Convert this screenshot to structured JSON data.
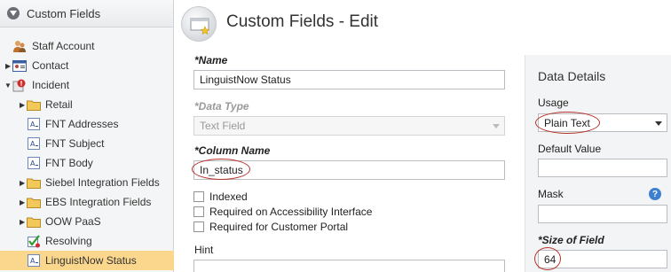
{
  "left_panel": {
    "title": "Custom Fields",
    "tree": [
      {
        "label": "Staff Account",
        "depth": 0,
        "expander": "",
        "icon": "staff-account-icon",
        "selected": false
      },
      {
        "label": "Contact",
        "depth": 0,
        "expander": "collapsed",
        "icon": "contact-card-icon",
        "selected": false
      },
      {
        "label": "Incident",
        "depth": 0,
        "expander": "expanded",
        "icon": "incident-icon",
        "selected": false
      },
      {
        "label": "Retail",
        "depth": 1,
        "expander": "collapsed",
        "icon": "folder-icon",
        "selected": false
      },
      {
        "label": "FNT Addresses",
        "depth": 1,
        "expander": "",
        "icon": "text-field-icon",
        "selected": false
      },
      {
        "label": "FNT Subject",
        "depth": 1,
        "expander": "",
        "icon": "text-field-icon",
        "selected": false
      },
      {
        "label": "FNT Body",
        "depth": 1,
        "expander": "",
        "icon": "text-field-icon",
        "selected": false
      },
      {
        "label": "Siebel Integration Fields",
        "depth": 1,
        "expander": "collapsed",
        "icon": "folder-icon",
        "selected": false
      },
      {
        "label": "EBS Integration Fields",
        "depth": 1,
        "expander": "collapsed",
        "icon": "folder-icon",
        "selected": false
      },
      {
        "label": "OOW PaaS",
        "depth": 1,
        "expander": "collapsed",
        "icon": "folder-icon",
        "selected": false
      },
      {
        "label": "Resolving",
        "depth": 1,
        "expander": "",
        "icon": "checkbox-field-icon",
        "selected": false
      },
      {
        "label": "LinguistNow Status",
        "depth": 1,
        "expander": "",
        "icon": "text-field-icon",
        "selected": true
      }
    ]
  },
  "header": {
    "title": "Custom Fields - Edit"
  },
  "form": {
    "name": {
      "label": "*Name",
      "value": "LinguistNow Status"
    },
    "data_type": {
      "label": "*Data Type",
      "value": "Text Field"
    },
    "column_name": {
      "label": "*Column Name",
      "value": "In_status"
    },
    "checkboxes": [
      {
        "label": "Indexed",
        "checked": false
      },
      {
        "label": "Required on Accessibility Interface",
        "checked": false
      },
      {
        "label": "Required for Customer Portal",
        "checked": false
      }
    ],
    "hint": {
      "label": "Hint",
      "value": ""
    }
  },
  "data_details": {
    "title": "Data Details",
    "usage": {
      "label": "Usage",
      "value": "Plain Text"
    },
    "default_value": {
      "label": "Default Value",
      "value": ""
    },
    "mask": {
      "label": "Mask",
      "value": "",
      "help": "?"
    },
    "size_of_field": {
      "label": "*Size of Field",
      "value": "64"
    }
  },
  "colors": {
    "selected_row": "#fbd78d",
    "annotation_oval": "#b8322b",
    "help_icon": "#3f7fd0"
  }
}
